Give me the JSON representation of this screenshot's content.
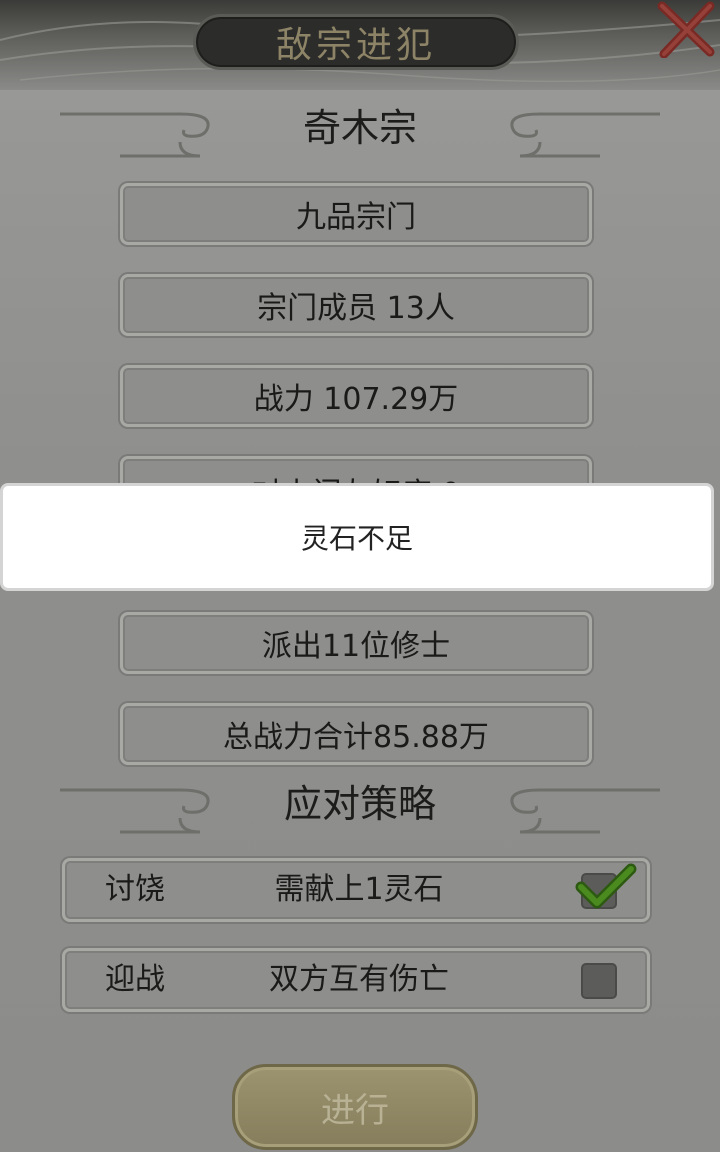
{
  "dialog": {
    "title": "敌宗进犯"
  },
  "enemy": {
    "name": "奇木宗",
    "info": [
      "九品宗门",
      "宗门成员 13人",
      "战力 107.29万",
      "对本门友好度 0"
    ]
  },
  "dispatch": {
    "members": "派出11位修士",
    "total_power": "总战力合计85.88万"
  },
  "strategy": {
    "heading": "应对策略",
    "options": [
      {
        "name": "讨饶",
        "desc": "需献上1灵石",
        "checked": true
      },
      {
        "name": "迎战",
        "desc": "双方互有伤亡",
        "checked": false
      }
    ]
  },
  "toast": {
    "message": "灵石不足"
  },
  "actions": {
    "proceed_label": "进行"
  },
  "colors": {
    "check_green": "#4a8a1e",
    "close_red": "#7a2a24",
    "title_text": "#8d8366"
  }
}
